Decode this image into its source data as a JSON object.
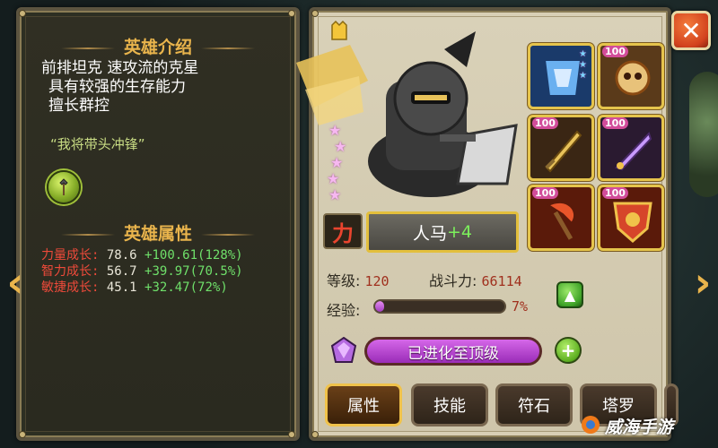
{
  "left_panel": {
    "faded_title": "…",
    "intro_title": "英雄介绍",
    "intro_lines": [
      "前排坦克  速攻流的克星",
      "具有较强的生存能力",
      "擅长群控"
    ],
    "quote": "“我将带头冲锋”",
    "skill_icon": "axe-icon",
    "attr_title": "英雄属性",
    "attributes": [
      {
        "label": "力量成长:",
        "value": "78.6",
        "bonus": "+100.61(128%)"
      },
      {
        "label": "智力成长:",
        "value": "56.7",
        "bonus": "+39.97(70.5%)"
      },
      {
        "label": "敏捷成长:",
        "value": "45.1",
        "bonus": "+32.47(72%)"
      }
    ]
  },
  "hero": {
    "type_icon": "力",
    "name": "人马",
    "plus": "+4",
    "star_count": 5,
    "level_label": "等级:",
    "level": "120",
    "power_label": "战斗力:",
    "power": "66114",
    "exp_label": "经验:",
    "exp_pct": "7%",
    "exp_fraction": 0.07,
    "evolve_text": "已进化至顶级"
  },
  "equipment": [
    {
      "icon": "armor-icon",
      "level": "",
      "color": "#3a7ad0"
    },
    {
      "icon": "skull-amulet-icon",
      "level": "100",
      "color": "#c8902a"
    },
    {
      "icon": "sword-icon",
      "level": "100",
      "color": "#6a3a1c"
    },
    {
      "icon": "dagger-icon",
      "level": "100",
      "color": "#4a2a44"
    },
    {
      "icon": "axe-icon",
      "level": "100",
      "color": "#8a2a12"
    },
    {
      "icon": "shield-icon",
      "level": "100",
      "color": "#8a2a12"
    }
  ],
  "tabs": [
    "属性",
    "技能",
    "符石",
    "塔罗"
  ],
  "close_label": "✕",
  "watermark": "威海手游",
  "colors": {
    "gold": "#e9b44c",
    "red_stat": "#ee4a3a",
    "green_bonus": "#6fe06a",
    "purple_bar": "#a23ec0"
  }
}
